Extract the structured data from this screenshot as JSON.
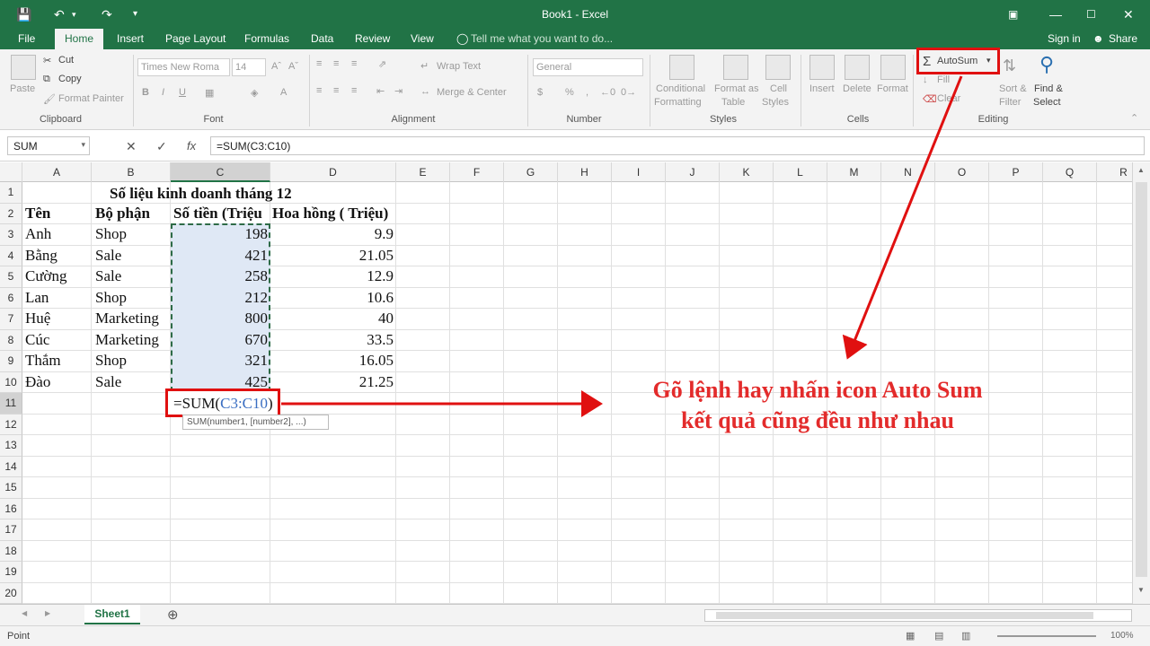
{
  "window": {
    "title": "Book1 - Excel",
    "ribbon_display_icon": "ribbon-display-icon",
    "minimize_icon": "minimize-icon",
    "maximize_icon": "maximize-icon",
    "close_icon": "close-icon",
    "accent": "#217346"
  },
  "tabs": {
    "file": "File",
    "home": "Home",
    "insert": "Insert",
    "page_layout": "Page Layout",
    "formulas": "Formulas",
    "data": "Data",
    "review": "Review",
    "view": "View",
    "tell_me": "Tell me what you want to do...",
    "sign_in": "Sign in",
    "share": "Share"
  },
  "ribbon": {
    "clipboard": {
      "paste": "Paste",
      "cut": "Cut",
      "copy": "Copy",
      "format_painter": "Format Painter",
      "label": "Clipboard"
    },
    "font": {
      "name": "Times New Roma",
      "size": "14",
      "label": "Font"
    },
    "alignment": {
      "wrap_text": "Wrap Text",
      "merge_center": "Merge & Center",
      "label": "Alignment"
    },
    "number": {
      "format": "General",
      "label": "Number"
    },
    "styles": {
      "conditional1": "Conditional",
      "conditional2": "Formatting",
      "format_as1": "Format as",
      "format_as2": "Table",
      "cell_styles1": "Cell",
      "cell_styles2": "Styles",
      "label": "Styles"
    },
    "cells": {
      "insert": "Insert",
      "delete": "Delete",
      "format": "Format",
      "label": "Cells"
    },
    "editing": {
      "autosum": "AutoSum",
      "fill": "Fill",
      "clear": "Clear",
      "sort1": "Sort &",
      "sort2": "Filter",
      "find1": "Find &",
      "find2": "Select",
      "label": "Editing"
    }
  },
  "formula_bar": {
    "name_box": "SUM",
    "cancel": "✕",
    "enter": "✓",
    "fx": "fx",
    "formula": "=SUM(C3:C10)"
  },
  "columns": [
    "A",
    "B",
    "C",
    "D",
    "E",
    "F",
    "G",
    "H",
    "I",
    "J",
    "K",
    "L",
    "M",
    "N",
    "O",
    "P",
    "Q",
    "R"
  ],
  "rows": [
    "1",
    "2",
    "3",
    "4",
    "5",
    "6",
    "7",
    "8",
    "9",
    "10",
    "11",
    "12",
    "13",
    "14",
    "15",
    "16",
    "17",
    "18",
    "19",
    "20"
  ],
  "sheet": {
    "title": "Số liệu kinh doanh tháng 12",
    "headers": [
      "Tên",
      "Bộ phận",
      "Số tiền (Triệu",
      "Hoa hồng ( Triệu)"
    ],
    "data": [
      [
        "Anh",
        "Shop",
        "198",
        "9.9"
      ],
      [
        "Bằng",
        "Sale",
        "421",
        "21.05"
      ],
      [
        "Cường",
        "Sale",
        "258",
        "12.9"
      ],
      [
        "Lan",
        "Shop",
        "212",
        "10.6"
      ],
      [
        "Huệ",
        "Marketing",
        "800",
        "40"
      ],
      [
        "Cúc",
        "Marketing",
        "670",
        "33.5"
      ],
      [
        "Thắm",
        "Shop",
        "321",
        "16.05"
      ],
      [
        "Đào",
        "Sale",
        "425",
        "21.25"
      ]
    ],
    "edit_prefix": "=SUM(",
    "edit_ref": "C3:C10",
    "edit_suffix": ")",
    "tooltip": "SUM(number1, [number2], ...)"
  },
  "annotation": {
    "line1": "Gõ lệnh hay nhấn icon Auto Sum",
    "line2": "kết quả cũng đều như nhau",
    "color": "#e32b2b"
  },
  "sheet_tabs": {
    "sheet1": "Sheet1",
    "add": "⊕"
  },
  "status": {
    "mode": "Point",
    "zoom": "100%"
  }
}
